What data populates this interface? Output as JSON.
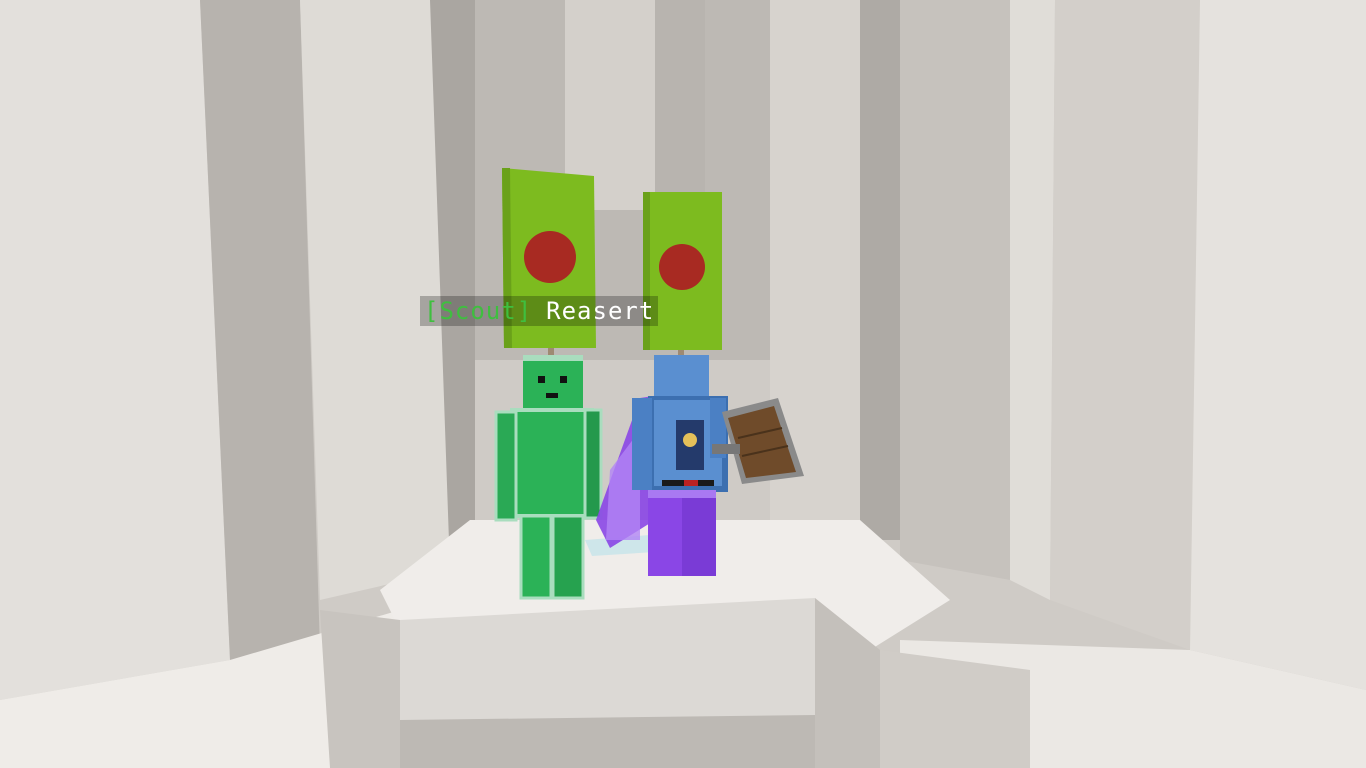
{
  "nametag": {
    "rank": "[Scout]",
    "player": "Reasert"
  },
  "colors": {
    "banner_green": "#7dbb1f",
    "banner_dot": "#a82a22",
    "armor_green": "#2bb257",
    "armor_purple": "#8a46e6",
    "tunic_blue": "#5a8fd0",
    "quartz_light": "#e6e3df"
  },
  "scene_objects": [
    "wall-pillars",
    "quartz-platform",
    "armor-stand-green",
    "armor-stand-purple",
    "banner-left",
    "banner-right",
    "shield"
  ]
}
